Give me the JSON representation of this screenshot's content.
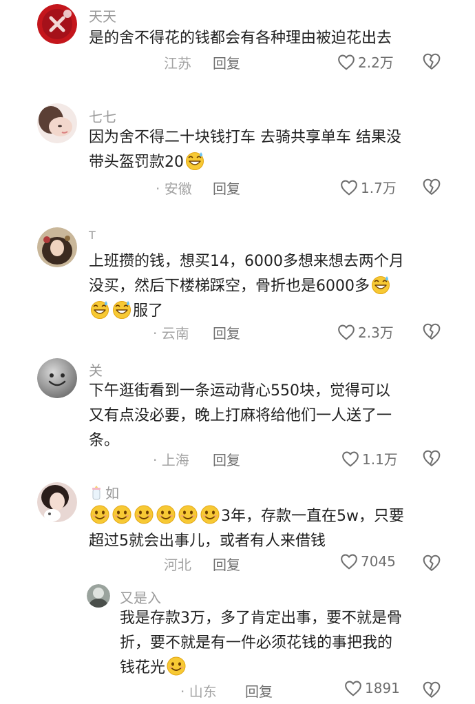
{
  "comments": [
    {
      "username": "天天",
      "text_parts": [
        "是的舍不得花的钱都会有各种理由被迫花出去"
      ],
      "location": "江苏",
      "reply_label": "回复",
      "likes": "2.2万"
    },
    {
      "username": "七七",
      "text_parts": [
        "因为舍不得二十块钱打车 去骑共享单车 结果没",
        "带头盔罚款20"
      ],
      "location": "· 安徽",
      "reply_label": "回复",
      "likes": "1.7万"
    },
    {
      "username": "T",
      "text_parts": [
        "上班攒的钱，想买14，6000多想来想去两个月",
        "没买，然后下楼梯踩空，骨折也是6000多",
        "服了"
      ],
      "location": "· 云南",
      "reply_label": "回复",
      "likes": "2.3万"
    },
    {
      "username": "关",
      "text_parts": [
        "下午逛街看到一条运动背心550块，觉得可以",
        "又有点没必要，晚上打麻将给他们一人送了一",
        "条。"
      ],
      "location": "· 上海",
      "reply_label": "回复",
      "likes": "1.1万"
    },
    {
      "username": "如",
      "text_parts": [
        "3年，存款一直在5w，只要",
        "超过5就会出事儿，或者有人来借钱"
      ],
      "location": "河北",
      "reply_label": "回复",
      "likes": "7045"
    },
    {
      "username": "又是入",
      "text_parts": [
        "我是存款3万，多了肯定出事，要不就是骨",
        "折，要不就是有一件必须花钱的事把我的",
        "钱花光"
      ],
      "location": "· 山东",
      "reply_label": "回复",
      "likes": "1891"
    }
  ],
  "icons": {
    "like": "heart-outline-icon",
    "dislike": "broken-heart-icon",
    "emoji_sweat": "grinning-sweat-emoji",
    "emoji_smile": "smiling-face-emoji"
  }
}
